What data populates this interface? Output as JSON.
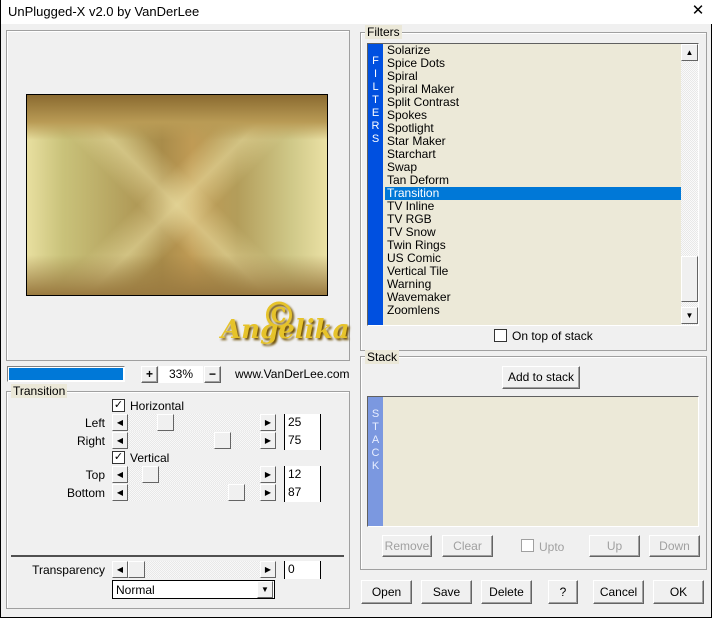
{
  "window": {
    "title": "UnPlugged-X v2.0 by VanDerLee",
    "close_glyph": "✕"
  },
  "preview": {
    "watermark": "Angelika",
    "watermark_mark": "C"
  },
  "zoom": {
    "value": "33%",
    "plus": "+",
    "minus": "−",
    "progress": 1.0,
    "website": "www.VanDerLee.com"
  },
  "transition": {
    "title": "Transition",
    "horizontal": {
      "label": "Horizontal",
      "checked": true
    },
    "vertical": {
      "label": "Vertical",
      "checked": true
    },
    "sliders": [
      {
        "label": "Left",
        "value": "25"
      },
      {
        "label": "Right",
        "value": "75"
      },
      {
        "label": "Top",
        "value": "12"
      },
      {
        "label": "Bottom",
        "value": "87"
      }
    ],
    "transparency": {
      "label": "Transparency",
      "value": "0"
    },
    "blend_mode": "Normal"
  },
  "filters": {
    "title": "Filters",
    "strip": "FILTERS",
    "items": [
      "Solarize",
      "Spice Dots",
      "Spiral",
      "Spiral Maker",
      "Split Contrast",
      "Spokes",
      "Spotlight",
      "Star Maker",
      "Starchart",
      "Swap",
      "Tan Deform",
      "Transition",
      "TV Inline",
      "TV RGB",
      "TV Snow",
      "Twin Rings",
      "US Comic",
      "Vertical Tile",
      "Warning",
      "Wavemaker",
      "Zoomlens"
    ],
    "selected": "Transition",
    "on_top_label": "On top of stack",
    "on_top_checked": false
  },
  "stack": {
    "title": "Stack",
    "strip": "STACK",
    "add_label": "Add to stack",
    "remove": "Remove",
    "clear": "Clear",
    "upto": "Upto",
    "up": "Up",
    "down": "Down"
  },
  "footer": {
    "open": "Open",
    "save": "Save",
    "delete": "Delete",
    "help": "?",
    "cancel": "Cancel",
    "ok": "OK"
  },
  "colors": {
    "filter_strip": "#0050e0",
    "stack_strip": "#7b98e0",
    "selection": "#0078d7",
    "list_bg": "#ece9d8"
  }
}
